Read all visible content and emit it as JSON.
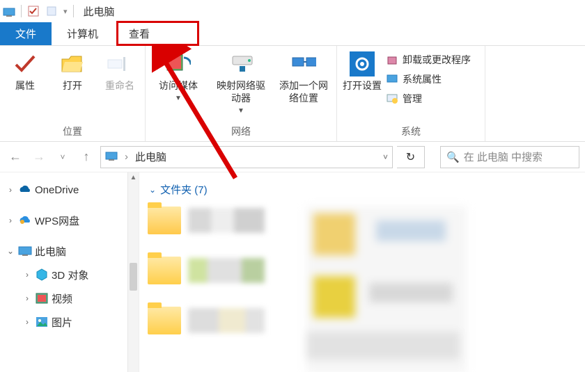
{
  "title": "此电脑",
  "tabs": {
    "file": "文件",
    "computer": "计算机",
    "view": "查看"
  },
  "ribbon": {
    "location": {
      "label": "位置",
      "properties": "属性",
      "open": "打开",
      "rename": "重命名"
    },
    "network": {
      "label": "网络",
      "access_media": "访问媒体",
      "map_drive": "映射网络驱动器",
      "add_location": "添加一个网络位置"
    },
    "system": {
      "label": "系统",
      "open_settings": "打开设置",
      "uninstall": "卸载或更改程序",
      "sys_props": "系统属性",
      "manage": "管理"
    }
  },
  "nav": {
    "path": "此电脑",
    "refresh_icon": "↻",
    "search_placeholder": "在 此电脑 中搜索"
  },
  "tree": {
    "onedrive": "OneDrive",
    "wps": "WPS网盘",
    "thispc": "此电脑",
    "threed": "3D 对象",
    "video": "视频",
    "pictures": "图片"
  },
  "folders_header": "文件夹 (7)"
}
